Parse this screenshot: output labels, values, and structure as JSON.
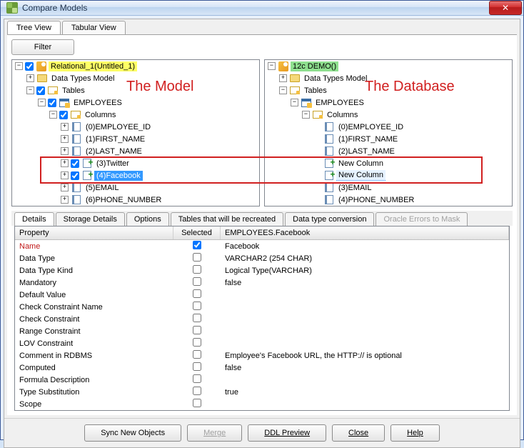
{
  "title": "Compare Models",
  "tabs": {
    "tree": "Tree View",
    "tabular": "Tabular View"
  },
  "filter": "Filter",
  "annotations": {
    "model": "The Model",
    "database": "The Database"
  },
  "left_tree": {
    "root": "Relational_1(Untitled_1)",
    "datatypes": "Data Types Model",
    "tables": "Tables",
    "table": "EMPLOYEES",
    "columns": "Columns",
    "cols": [
      "(0)EMPLOYEE_ID",
      "(1)FIRST_NAME",
      "(2)LAST_NAME",
      "(3)Twitter",
      "(4)Facebook",
      "(5)EMAIL",
      "(6)PHONE_NUMBER"
    ]
  },
  "right_tree": {
    "root": "12c DEMO()",
    "datatypes": "Data Types Model",
    "tables": "Tables",
    "table": "EMPLOYEES",
    "columns": "Columns",
    "cols": [
      "(0)EMPLOYEE_ID",
      "(1)FIRST_NAME",
      "(2)LAST_NAME",
      "New Column",
      "New Column",
      "(3)EMAIL",
      "(4)PHONE_NUMBER"
    ]
  },
  "detail_tabs": [
    "Details",
    "Storage Details",
    "Options",
    "Tables that will be recreated",
    "Data type conversion",
    "Oracle Errors to Mask"
  ],
  "grid": {
    "headers": {
      "property": "Property",
      "selected": "Selected",
      "value": "EMPLOYEES.Facebook"
    },
    "rows": [
      {
        "prop": "Name",
        "sel": true,
        "val": "Facebook",
        "red": true
      },
      {
        "prop": "Data Type",
        "sel": false,
        "val": "VARCHAR2 (254 CHAR)"
      },
      {
        "prop": "Data Type Kind",
        "sel": false,
        "val": "Logical Type(VARCHAR)"
      },
      {
        "prop": "Mandatory",
        "sel": false,
        "val": "false"
      },
      {
        "prop": "Default Value",
        "sel": false,
        "val": ""
      },
      {
        "prop": "Check Constraint Name",
        "sel": false,
        "val": ""
      },
      {
        "prop": "Check Constraint",
        "sel": false,
        "val": ""
      },
      {
        "prop": "Range Constraint",
        "sel": false,
        "val": ""
      },
      {
        "prop": "LOV Constraint",
        "sel": false,
        "val": ""
      },
      {
        "prop": "Comment in RDBMS",
        "sel": false,
        "val": "Employee's Facebook URL, the HTTP:// is optional"
      },
      {
        "prop": "Computed",
        "sel": false,
        "val": "false"
      },
      {
        "prop": "Formula Description",
        "sel": false,
        "val": ""
      },
      {
        "prop": "Type Substitution",
        "sel": false,
        "val": "true"
      },
      {
        "prop": "Scope",
        "sel": false,
        "val": ""
      }
    ]
  },
  "buttons": {
    "sync": "Sync New Objects",
    "merge": "Merge",
    "ddl": "DDL Preview",
    "close": "Close",
    "help": "Help"
  }
}
